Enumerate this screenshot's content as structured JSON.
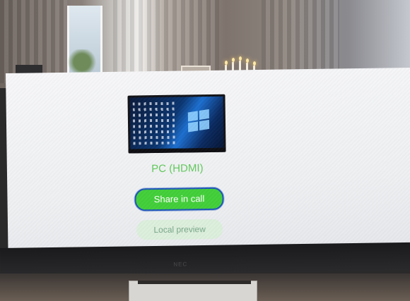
{
  "source": {
    "label": "PC (HDMI)",
    "thumbnail": "windows-desktop-screenshot"
  },
  "actions": {
    "share_label": "Share in call",
    "preview_label": "Local preview"
  },
  "bezel": {
    "brand": "NEC"
  },
  "colors": {
    "accent_green": "#43cf3a",
    "label_green": "#63c95d",
    "focus_ring": "#1f57b8",
    "secondary_button": "#dcefdc"
  }
}
